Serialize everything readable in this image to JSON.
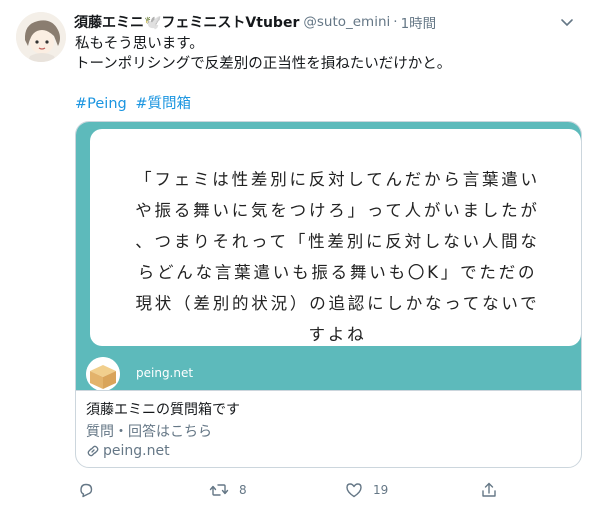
{
  "tweet": {
    "display_name": "須藤エミニ🕊️フェミニストVtuber",
    "handle": "@suto_emini",
    "separator": "·",
    "time": "1時間",
    "body_lines": [
      "私もそう思います。",
      "トーンポリシングで反差別の正当性を損ねたいだけかと。"
    ],
    "hashtags": [
      "#Peing",
      "#質問箱"
    ],
    "icons": {
      "avatar": "avatar",
      "more": "chevron-down-icon"
    }
  },
  "card": {
    "question_lines": [
      "「フェミは性差別に反対してんだから言葉遣い",
      "や振る舞いに気をつけろ」って人がいましたが",
      "、つまりそれって「性差別に反対しない人間な",
      "らどんな言葉遣いも振る舞いも〇K」でただの",
      "現状（差別的状況）の追認にしかなってないで",
      "すよね"
    ],
    "site_name": "peing.net",
    "title": "須藤エミニの質問箱です",
    "description": "質問・回答はこちら",
    "link": "peing.net",
    "colors": {
      "teal": "#5dbabb",
      "link": "#1b95e0"
    }
  },
  "actions": {
    "reply_count": "",
    "retweet_count": "8",
    "like_count": "19",
    "icons": [
      "reply-icon",
      "retweet-icon",
      "like-icon",
      "share-icon"
    ]
  }
}
